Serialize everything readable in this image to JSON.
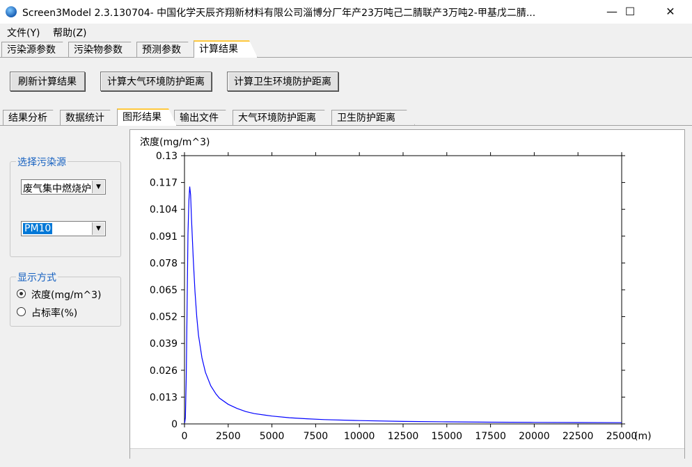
{
  "window": {
    "title": "Screen3Model 2.3.130704- 中国化学天辰齐翔新材料有限公司淄博分厂年产23万吨己二腈联产3万吨2-甲基戊二腈...",
    "minimize": "—",
    "maximize": "☐",
    "close": "✕"
  },
  "menu": {
    "file": "文件(Y)",
    "help": "帮助(Z)"
  },
  "main_tabs": [
    "污染源参数",
    "污染物参数",
    "预测参数",
    "计算结果"
  ],
  "buttons": {
    "refresh": "刷新计算结果",
    "atmos": "计算大气环境防护距离",
    "health": "计算卫生环境防护距离"
  },
  "sub_tabs": [
    "结果分析",
    "数据统计",
    "图形结果",
    "输出文件",
    "大气环境防护距离",
    "卫生防护距离"
  ],
  "source_group": {
    "title": "选择污染源",
    "source_value": "废气集中燃烧炉",
    "pollutant_value": "PM10"
  },
  "display_group": {
    "title": "显示方式",
    "option_conc": "浓度(mg/m^3)",
    "option_ratio": "占标率(%)",
    "selected": "浓度(mg/m^3)"
  },
  "colors": {
    "line": "#0000ff",
    "groupTitle": "#1560c0",
    "selection": "#0078d7"
  },
  "chart_data": {
    "type": "line",
    "ylabel": "浓度(mg/m^3)",
    "xlabel_unit": "(m)",
    "xlim": [
      0,
      25000
    ],
    "ylim": [
      0,
      0.13
    ],
    "x_ticks": [
      0,
      2500,
      5000,
      7500,
      10000,
      12500,
      15000,
      17500,
      20000,
      22500,
      25000
    ],
    "x_tick_labels": [
      "0",
      "2500",
      "5000",
      "7500",
      "10000",
      "12500",
      "15000",
      "17500",
      "20000",
      "22500",
      "25000"
    ],
    "y_ticks": [
      0,
      0.013,
      0.026,
      0.039,
      0.052,
      0.065,
      0.078,
      0.091,
      0.104,
      0.117,
      0.13
    ],
    "y_tick_labels": [
      "0",
      "0.013",
      "0.026",
      "0.039",
      "0.052",
      "0.065",
      "0.078",
      "0.091",
      "0.104",
      "0.117",
      "0.13"
    ],
    "grid": false,
    "series": [
      {
        "color": "#0000ff",
        "x": [
          10,
          50,
          100,
          150,
          200,
          250,
          300,
          350,
          400,
          500,
          600,
          700,
          800,
          1000,
          1200,
          1500,
          1800,
          2000,
          2500,
          3000,
          3500,
          4000,
          5000,
          6000,
          7000,
          8000,
          10000,
          12500,
          15000,
          17500,
          20000,
          22500,
          25000
        ],
        "y": [
          0.0005,
          0.003,
          0.022,
          0.058,
          0.092,
          0.108,
          0.115,
          0.111,
          0.1,
          0.08,
          0.064,
          0.052,
          0.043,
          0.032,
          0.025,
          0.0185,
          0.0145,
          0.0125,
          0.0095,
          0.0075,
          0.006,
          0.005,
          0.0038,
          0.003,
          0.0025,
          0.0021,
          0.0016,
          0.0012,
          0.001,
          0.00085,
          0.00075,
          0.00068,
          0.0006
        ]
      }
    ]
  }
}
